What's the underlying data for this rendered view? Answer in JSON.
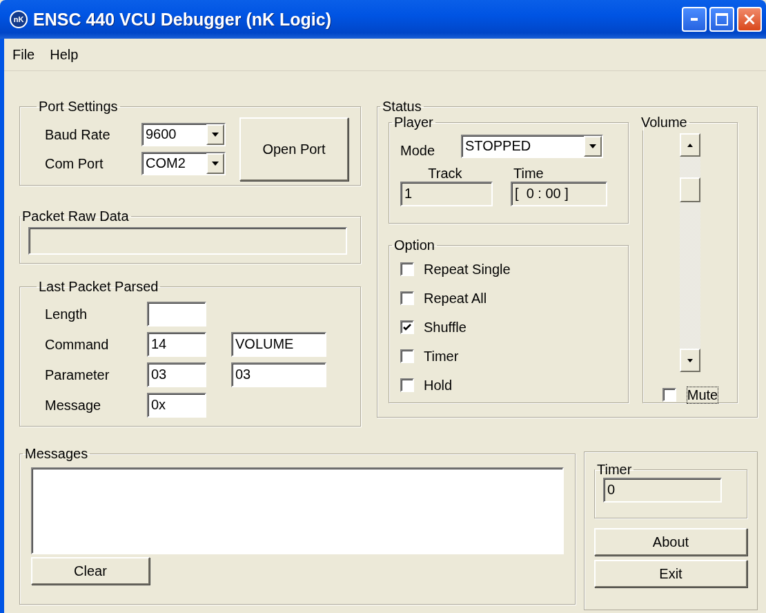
{
  "window": {
    "title": "ENSC 440 VCU Debugger (nK Logic)",
    "icon_text": "nK"
  },
  "menu": [
    {
      "label": "File"
    },
    {
      "label": "Help"
    }
  ],
  "port_settings": {
    "title": "Port Settings",
    "baud_rate": {
      "label": "Baud Rate",
      "value": "9600"
    },
    "com_port": {
      "label": "Com Port",
      "value": "COM2"
    },
    "open_button": {
      "label": "Open Port"
    }
  },
  "packet_raw_data": {
    "title": "Packet Raw Data",
    "read_only": true
  },
  "last_packet": {
    "title": "Last Packet Parsed",
    "rows": [
      {
        "label": "Length",
        "fields": [
          {
            "read_only": false
          }
        ]
      },
      {
        "label": "Command",
        "fields": [
          {
            "value": "14",
            "read_only": false
          },
          {
            "value": "VOLUME",
            "read_only": false
          }
        ]
      },
      {
        "label": "Parameter",
        "fields": [
          {
            "value": "03",
            "read_only": false
          },
          {
            "value": "03",
            "read_only": false
          }
        ]
      },
      {
        "label": "Message",
        "fields": [
          {
            "value": "0x",
            "read_only": false
          }
        ]
      }
    ]
  },
  "status": {
    "title": "Status",
    "player": {
      "title": "Player",
      "mode_label": "Mode",
      "mode": "STOPPED",
      "track_label": "Track",
      "track": "1",
      "time_label": "Time",
      "time": "[  0 : 00 ]"
    },
    "option": {
      "title": "Option",
      "items": [
        {
          "label": "Repeat Single",
          "checked": false
        },
        {
          "label": "Repeat All",
          "checked": false
        },
        {
          "label": "Shuffle",
          "checked": true
        },
        {
          "label": "Timer",
          "checked": false
        },
        {
          "label": "Hold",
          "checked": false
        }
      ]
    },
    "volume": {
      "title": "Volume",
      "mute": {
        "label": "Mute",
        "checked": false,
        "focused": true
      }
    }
  },
  "messages": {
    "title": "Messages",
    "clear_button": {
      "label": "Clear"
    }
  },
  "timer": {
    "title": "Timer",
    "value": "0",
    "read_only": true
  },
  "buttons": [
    {
      "label": "About"
    },
    {
      "label": "Exit"
    }
  ]
}
